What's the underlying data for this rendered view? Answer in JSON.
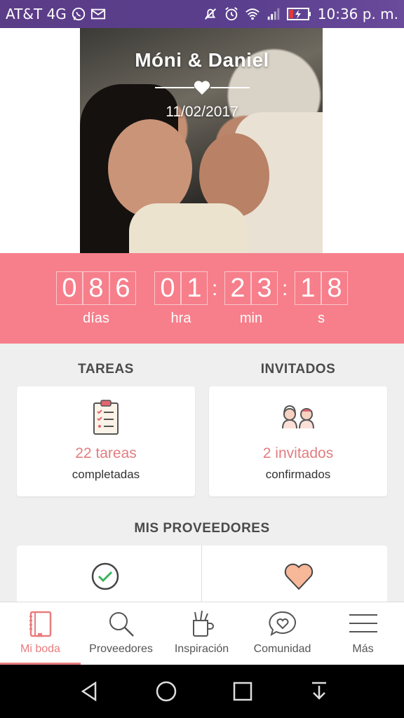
{
  "status_bar": {
    "carrier": "AT&T 4G",
    "time": "10:36 p. m.",
    "icons": [
      "whatsapp-icon",
      "mail-icon",
      "mute-icon",
      "alarm-icon",
      "wifi-icon",
      "signal-icon",
      "battery-charging-icon"
    ]
  },
  "hero": {
    "names": "Móni & Daniel",
    "date": "11/02/2017"
  },
  "countdown": {
    "days": [
      "0",
      "8",
      "6"
    ],
    "hours": [
      "0",
      "1"
    ],
    "minutes": [
      "2",
      "3"
    ],
    "seconds": [
      "1",
      "8"
    ],
    "labels": {
      "days": "días",
      "hours": "hra",
      "minutes": "min",
      "seconds": "s"
    }
  },
  "tasks": {
    "title": "TAREAS",
    "count": "22 tareas",
    "sub": "completadas",
    "icon": "clipboard-checklist-icon"
  },
  "guests": {
    "title": "INVITADOS",
    "count": "2 invitados",
    "sub": "confirmados",
    "icon": "guests-couple-icon"
  },
  "providers": {
    "title": "MIS PROVEEDORES",
    "icons": [
      "check-circle-icon",
      "heart-icon"
    ]
  },
  "bottom_nav": {
    "items": [
      {
        "label": "Mi boda",
        "icon": "notebook-icon",
        "active": true
      },
      {
        "label": "Proveedores",
        "icon": "search-icon",
        "active": false
      },
      {
        "label": "Inspiración",
        "icon": "pencil-cup-icon",
        "active": false
      },
      {
        "label": "Comunidad",
        "icon": "chat-heart-icon",
        "active": false
      },
      {
        "label": "Más",
        "icon": "menu-icon",
        "active": false
      }
    ]
  },
  "colors": {
    "status_bar": "#5b3c87",
    "countdown_bg": "#f67f8b",
    "accent": "#e87c7e",
    "page_bg": "#efefef"
  }
}
